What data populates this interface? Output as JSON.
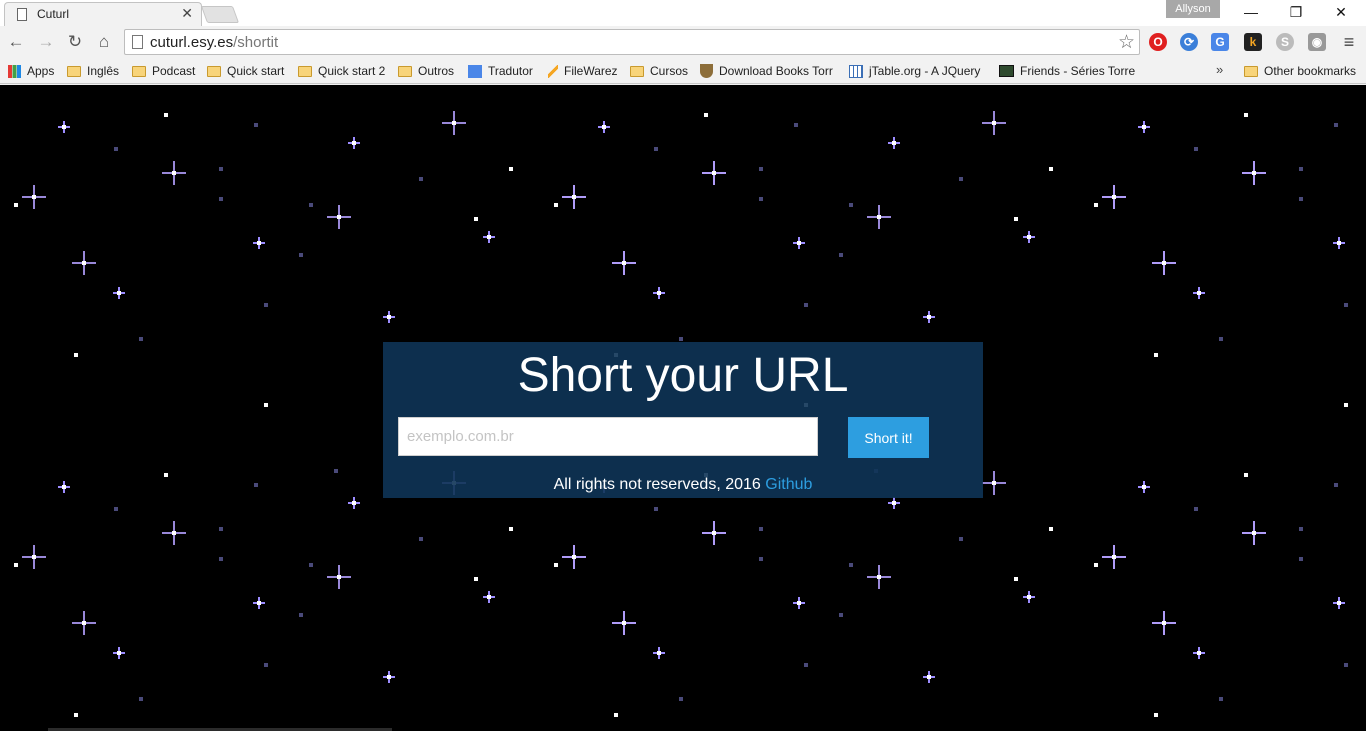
{
  "browser": {
    "tab_title": "Cuturl",
    "tab_close": "✕",
    "profile_name": "Allyson",
    "url_host": "cuturl.esy.es",
    "url_path": "/shortit"
  },
  "bookmarks": [
    {
      "label": "Apps",
      "icon": "apps-icon"
    },
    {
      "label": "Inglês",
      "icon": "folder-icon"
    },
    {
      "label": "Podcast",
      "icon": "folder-icon"
    },
    {
      "label": "Quick start",
      "icon": "folder-icon"
    },
    {
      "label": "Quick start 2",
      "icon": "folder-icon"
    },
    {
      "label": "Outros",
      "icon": "folder-icon"
    },
    {
      "label": "Tradutor",
      "icon": "translate-icon"
    },
    {
      "label": "FileWarez",
      "icon": "filewarez-icon"
    },
    {
      "label": "Cursos",
      "icon": "folder-icon"
    },
    {
      "label": "Download Books Torr",
      "icon": "shield-icon"
    },
    {
      "label": "jTable.org - A JQuery",
      "icon": "jtable-icon"
    },
    {
      "label": "Friends - Séries Torre",
      "icon": "series-icon"
    },
    {
      "label": "Other bookmarks",
      "icon": "folder-icon"
    }
  ],
  "page": {
    "title": "Short your URL",
    "input_placeholder": "exemplo.com.br",
    "button_label": "Short it!",
    "footer_text": "All rights not reserveds, 2016",
    "footer_link": "Github"
  },
  "colors": {
    "background": "#000000",
    "panel": "#0e3456",
    "button": "#2d9ee0",
    "link": "#2d9ee0"
  }
}
